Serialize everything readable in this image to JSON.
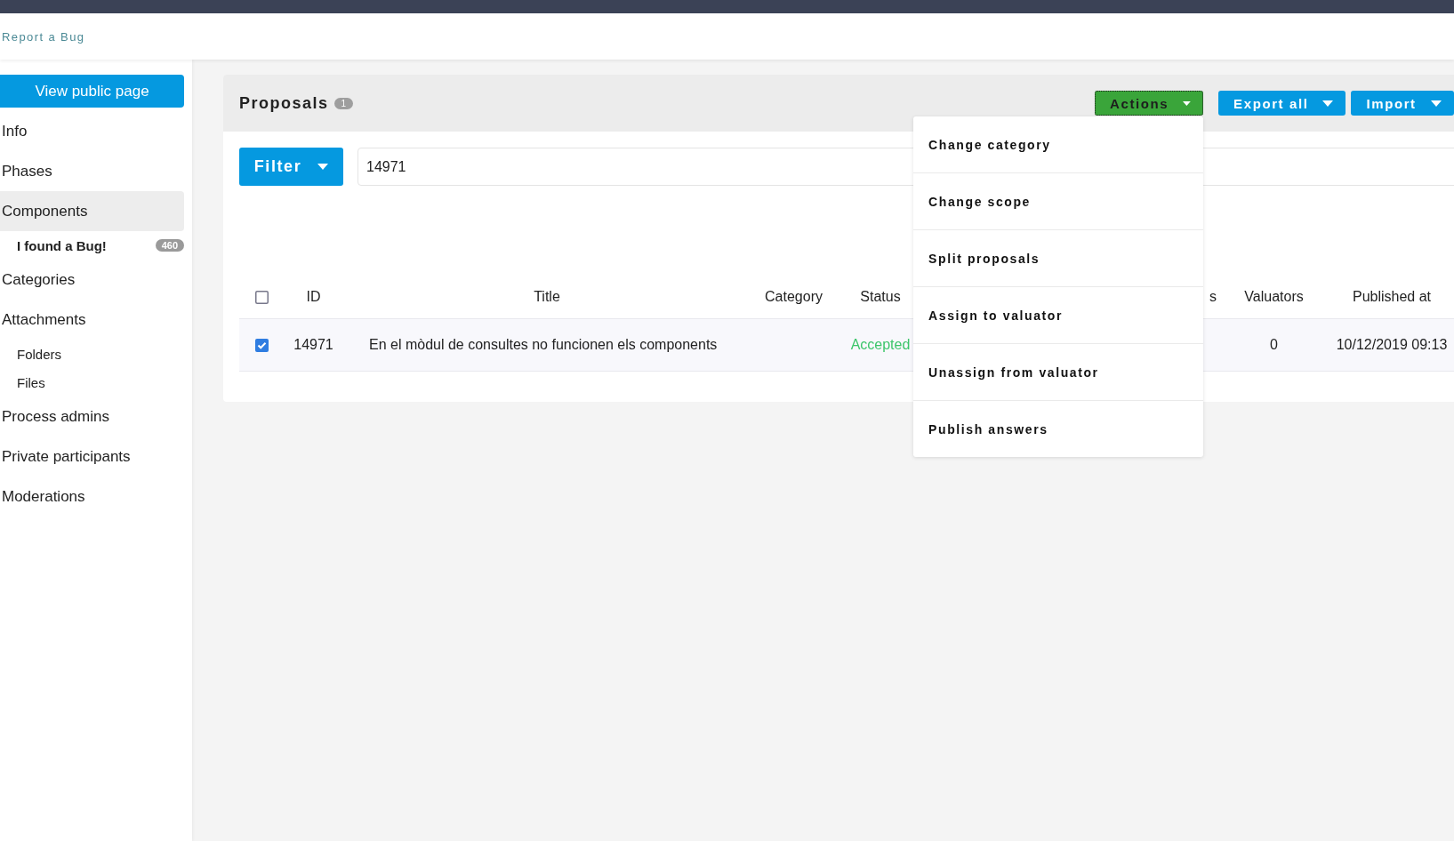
{
  "top_bar": {
    "link": "Report a Bug"
  },
  "sidebar": {
    "public_button": "View public page",
    "items": [
      {
        "label": "Info",
        "selected": false
      },
      {
        "label": "Phases",
        "selected": false
      },
      {
        "label": "Components",
        "selected": true,
        "children": [
          {
            "label": "I found a Bug!",
            "count": "460",
            "selected": true
          }
        ]
      },
      {
        "label": "Categories",
        "selected": false
      },
      {
        "label": "Attachments",
        "selected": false,
        "children": [
          {
            "label": "Folders",
            "selected": false
          },
          {
            "label": "Files",
            "selected": false
          }
        ]
      },
      {
        "label": "Process admins",
        "selected": false
      },
      {
        "label": "Private participants",
        "selected": false
      },
      {
        "label": "Moderations",
        "selected": false
      }
    ]
  },
  "card": {
    "title": "Proposals",
    "count": "1",
    "actions": {
      "label": "Actions",
      "expanded": true,
      "menu": [
        "Change category",
        "Change scope",
        "Split proposals",
        "Assign to valuator",
        "Unassign from valuator",
        "Publish answers"
      ]
    },
    "buttons": [
      "Export all",
      "Import"
    ],
    "filter": {
      "label": "Filter",
      "search_value": "14971"
    },
    "table": {
      "select_all": {
        "checked": false
      },
      "columns": [
        "ID",
        "Title",
        "Category",
        "Status",
        "s",
        "Valuators",
        "Published at"
      ],
      "rows": [
        {
          "checked": true,
          "id": "14971",
          "title": "En el mòdul de consultes no funcionen els components",
          "status": "Accepted",
          "color": "#3cc56a",
          "valuators": "0",
          "published_at": "10/12/2019 09:13"
        }
      ]
    }
  }
}
